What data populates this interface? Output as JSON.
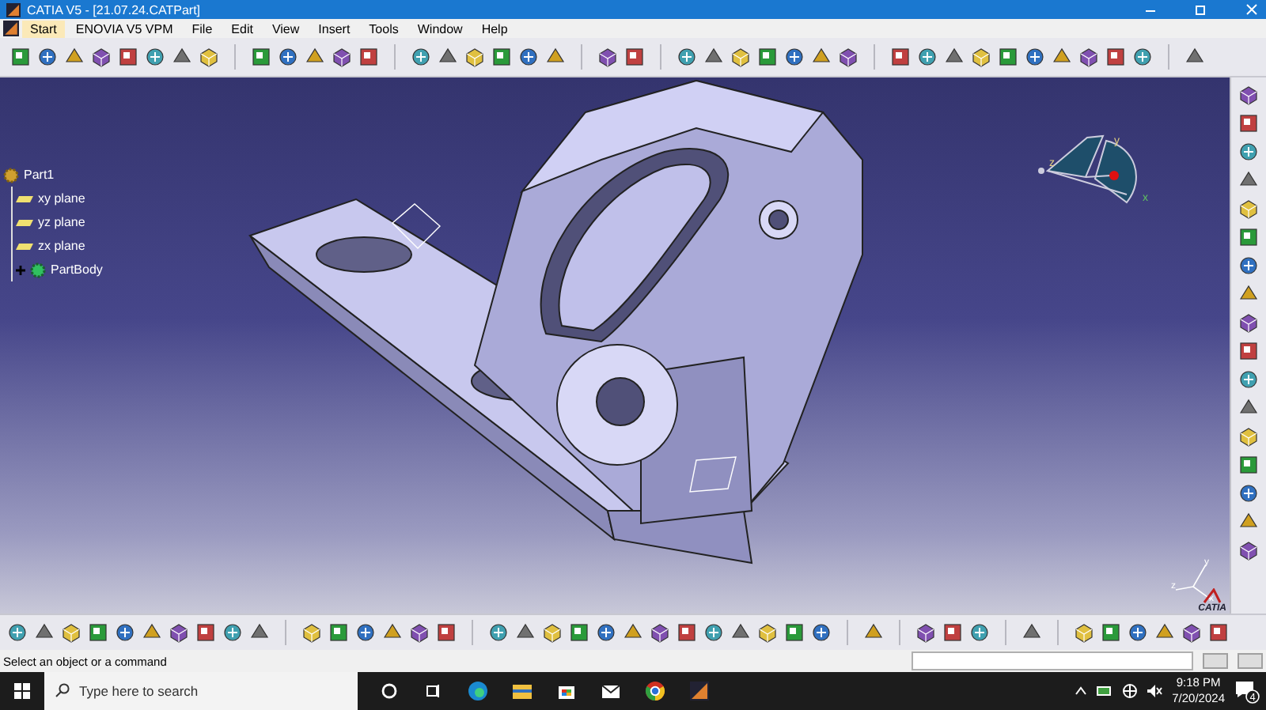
{
  "window": {
    "title": "CATIA V5 - [21.07.24.CATPart]"
  },
  "menu": [
    {
      "label": "Start",
      "selected": true
    },
    {
      "label": "ENOVIA V5 VPM",
      "selected": false
    },
    {
      "label": "File",
      "selected": false
    },
    {
      "label": "Edit",
      "selected": false
    },
    {
      "label": "View",
      "selected": false
    },
    {
      "label": "Insert",
      "selected": false
    },
    {
      "label": "Tools",
      "selected": false
    },
    {
      "label": "Window",
      "selected": false
    },
    {
      "label": "Help",
      "selected": false
    }
  ],
  "tree": {
    "label": "Part1",
    "children": [
      {
        "label": "xy plane",
        "kind": "plane"
      },
      {
        "label": "yz plane",
        "kind": "plane"
      },
      {
        "label": "zx plane",
        "kind": "plane"
      },
      {
        "label": "PartBody",
        "kind": "body",
        "expanded": false
      }
    ]
  },
  "compass_labels": [
    "y",
    "z",
    "x"
  ],
  "triad_labels": [
    "y",
    "z",
    "x"
  ],
  "logo": {
    "text": "CATIA"
  },
  "status_bar": {
    "message": "Select an object or a command"
  },
  "taskbar": {
    "search_placeholder": "Type here to search",
    "time": "9:18 PM",
    "date": "7/20/2024",
    "notifications": "4"
  }
}
